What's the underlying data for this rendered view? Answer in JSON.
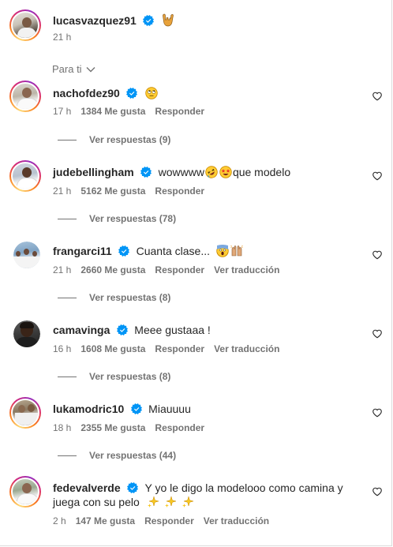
{
  "post": {
    "username": "lucasvazquez91",
    "caption_emoji": "horns-hand-emoji",
    "time": "21 h"
  },
  "filter": {
    "label": "Para ti"
  },
  "actions": {
    "reply": "Responder",
    "translate": "Ver traducción"
  },
  "comments": [
    {
      "username": "nachofdez90",
      "text": "",
      "emojis": [
        "face-with-rolling-eyes-emoji"
      ],
      "time": "17 h",
      "likes": "1384 Me gusta",
      "translate": false,
      "replies": "Ver respuestas (9)"
    },
    {
      "username": "judebellingham",
      "text_before": "wowwww",
      "text_after": "que modelo",
      "emojis": [
        "rolling-on-floor-laughing-emoji",
        "star-struck-emoji"
      ],
      "time": "21 h",
      "likes": "5162 Me gusta",
      "translate": false,
      "replies": "Ver respuestas (78)"
    },
    {
      "username": "frangarci11",
      "text": "Cuanta clase...",
      "emojis": [
        "face-screaming-emoji",
        "raising-hands-emoji"
      ],
      "time": "21 h",
      "likes": "2660 Me gusta",
      "translate": true,
      "replies": "Ver respuestas (8)"
    },
    {
      "username": "camavinga",
      "text": "Meee gustaaa !",
      "emojis": [],
      "time": "16 h",
      "likes": "1608 Me gusta",
      "translate": true,
      "replies": "Ver respuestas (8)"
    },
    {
      "username": "lukamodric10",
      "text": "Miauuuu",
      "emojis": [],
      "time": "18 h",
      "likes": "2355 Me gusta",
      "translate": false,
      "replies": "Ver respuestas (44)"
    },
    {
      "username": "fedevalverde",
      "text_line1": "Y yo le digo la modelooo como camina y",
      "text_line2": "juega con su pelo",
      "emojis": [
        "sparkles-emoji",
        "sparkles-emoji",
        "sparkles-emoji"
      ],
      "time": "2 h",
      "likes": "147 Me gusta",
      "translate": true,
      "replies": ""
    }
  ],
  "colors": {
    "verified": "#0095f6",
    "meta": "#737373",
    "text": "#262626"
  }
}
